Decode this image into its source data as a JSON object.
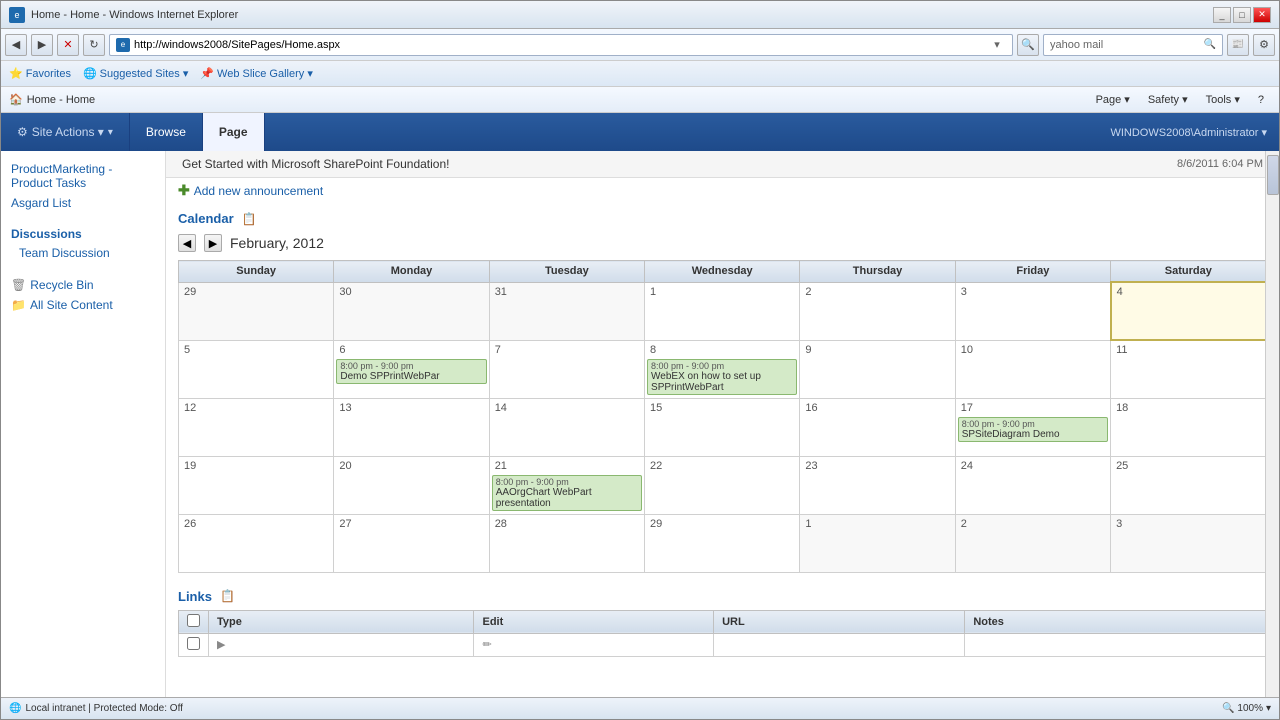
{
  "browser": {
    "title": "Home - Home - Windows Internet Explorer",
    "url": "http://windows2008/SitePages/Home.aspx",
    "search_placeholder": "yahoo mail",
    "favorites": [
      "Favorites",
      "Suggested Sites ▾",
      "Web Slice Gallery ▾"
    ],
    "nav_back": "◀",
    "nav_forward": "▶",
    "breadcrumb": "Home - Home",
    "tools": {
      "page": "Page ▾",
      "safety": "Safety ▾",
      "tools": "Tools ▾",
      "help": "?"
    }
  },
  "sharepoint": {
    "ribbon_tabs": [
      "Site Actions ▾",
      "Browse",
      "Page"
    ],
    "user": "WINDOWS2008\\Administrator ▾",
    "announcement": {
      "text": "Get Started with Microsoft SharePoint Foundation!",
      "date": "8/6/2011 6:04 PM"
    },
    "add_announcement_label": "Add new announcement",
    "sidebar": {
      "product_marketing": "ProductMarketing - Product Tasks",
      "asgard_list": "Asgard List",
      "discussions_header": "Discussions",
      "team_discussion": "Team Discussion",
      "recycle_bin": "Recycle Bin",
      "all_site_content": "All Site Content"
    },
    "calendar": {
      "title": "Calendar",
      "month": "February, 2012",
      "days": [
        "Sunday",
        "Monday",
        "Tuesday",
        "Wednesday",
        "Thursday",
        "Friday",
        "Saturday"
      ],
      "weeks": [
        [
          {
            "date": "29",
            "other": true,
            "events": []
          },
          {
            "date": "30",
            "other": true,
            "events": []
          },
          {
            "date": "31",
            "other": true,
            "events": []
          },
          {
            "date": "1",
            "events": []
          },
          {
            "date": "2",
            "events": []
          },
          {
            "date": "3",
            "events": []
          },
          {
            "date": "4",
            "today": true,
            "events": []
          }
        ],
        [
          {
            "date": "5",
            "events": []
          },
          {
            "date": "6",
            "events": [
              {
                "time": "8:00 pm - 9:00 pm",
                "title": "Demo SPPrintWebPar"
              }
            ]
          },
          {
            "date": "7",
            "events": []
          },
          {
            "date": "8",
            "events": [
              {
                "time": "8:00 pm - 9:00 pm",
                "title": "WebEX on how to set up SPPrintWebPart"
              }
            ]
          },
          {
            "date": "9",
            "events": []
          },
          {
            "date": "10",
            "events": []
          },
          {
            "date": "11",
            "events": []
          }
        ],
        [
          {
            "date": "12",
            "events": []
          },
          {
            "date": "13",
            "events": []
          },
          {
            "date": "14",
            "events": []
          },
          {
            "date": "15",
            "events": []
          },
          {
            "date": "16",
            "events": []
          },
          {
            "date": "17",
            "events": [
              {
                "time": "8:00 pm - 9:00 pm",
                "title": "SPSiteDiagram Demo"
              }
            ]
          },
          {
            "date": "18",
            "events": []
          }
        ],
        [
          {
            "date": "19",
            "events": []
          },
          {
            "date": "20",
            "events": []
          },
          {
            "date": "21",
            "events": [
              {
                "time": "8:00 pm - 9:00 pm",
                "title": "AAOrgChart WebPart presentation"
              }
            ]
          },
          {
            "date": "22",
            "events": []
          },
          {
            "date": "23",
            "events": []
          },
          {
            "date": "24",
            "events": []
          },
          {
            "date": "25",
            "events": []
          }
        ],
        [
          {
            "date": "26",
            "events": []
          },
          {
            "date": "27",
            "events": []
          },
          {
            "date": "28",
            "events": []
          },
          {
            "date": "29",
            "events": []
          },
          {
            "date": "1",
            "other": true,
            "events": []
          },
          {
            "date": "2",
            "other": true,
            "events": []
          },
          {
            "date": "3",
            "other": true,
            "events": []
          }
        ]
      ]
    },
    "links": {
      "title": "Links",
      "columns": [
        "Type",
        "Edit",
        "URL",
        "Notes"
      ],
      "col_checkbox": ""
    }
  },
  "statusbar": {
    "zone": "Local intranet | Protected Mode: Off",
    "zoom": "100%"
  }
}
